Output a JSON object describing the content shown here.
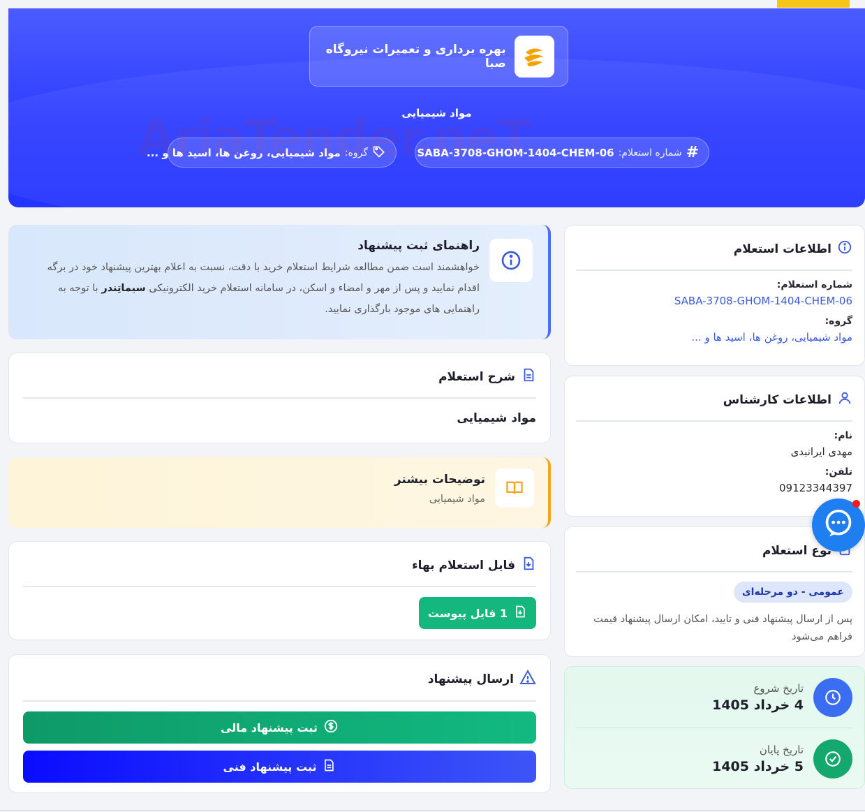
{
  "hero": {
    "org_name": "بهره برداری و تعمیرات نیروگاه صبا",
    "title": "مواد شیمیایی",
    "number_label": "شماره استعلام:",
    "number_value": "SABA-3708-GHOM-1404-CHEM-06",
    "group_label": "گروه:",
    "group_value": "مواد شیمیایی، روغن ها، اسید ها و ...",
    "watermark": "AriaTender.neT"
  },
  "info": {
    "title": "اطلاعات استعلام",
    "number_label": "شماره استعلام:",
    "number_value": "SABA-3708-GHOM-1404-CHEM-06",
    "group_label": "گروه:",
    "group_value": "مواد شیمیایی، روغن ها، اسید ها و ..."
  },
  "expert": {
    "title": "اطلاعات کارشناس",
    "name_label": "نام:",
    "name_value": "مهدی ایرانبدی",
    "phone_label": "تلفن:",
    "phone_value": "09123344397"
  },
  "type": {
    "title": "نوع استعلام",
    "badge": "عمومی - دو مرحله‌ای",
    "description": "پس از ارسال پیشنهاد فنی و تایید، امکان ارسال پیشنهاد قیمت فراهم می‌شود"
  },
  "dates": {
    "start_label": "تاریخ شروع",
    "start_value": "4 خرداد 1405",
    "end_label": "تاریخ پایان",
    "end_value": "5 خرداد 1405"
  },
  "guide": {
    "title": "راهنمای ثبت پیشنهاد",
    "text_1": "خواهشمند است ضمن مطالعه شرایط استعلام خرید با دقت، نسبت به اعلام بهترین پیشنهاد خود در برگه اقدام نمایید و پس از مهر و امضاء و اسکن، در سامانه استعلام خرید الکترونیکی",
    "brand": "سیماتِندر",
    "text_2": "با توجه به راهنمایی های موجود بارگذاری نمایید."
  },
  "description": {
    "title": "شرح استعلام",
    "value": "مواد شیمیایی"
  },
  "more": {
    "title": "توضیحات بیشتر",
    "value": "مواد شیمیایی"
  },
  "file": {
    "title": "فایل استعلام بهاء",
    "button": "1 فایل پیوست"
  },
  "send": {
    "title": "ارسال پیشنهاد",
    "financial_button": "ثبت پیشنهاد مالی",
    "technical_button": "ثبت پیشنهاد فنی"
  },
  "colors": {
    "primary": "#2d3cff",
    "accent_yellow": "#f5c518",
    "green": "#14b87f",
    "link": "#3b5bdb"
  }
}
